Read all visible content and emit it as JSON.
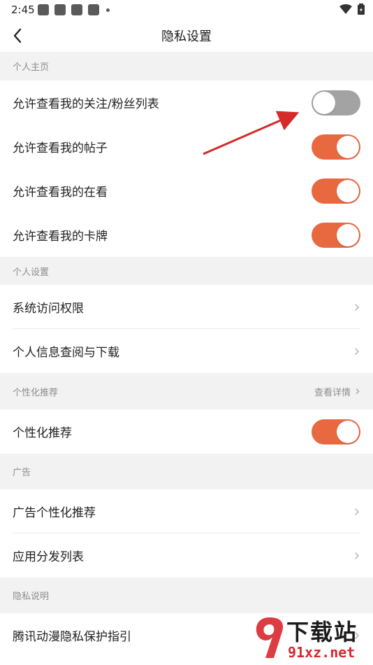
{
  "status_bar": {
    "time": "2:45"
  },
  "header": {
    "title": "隐私设置"
  },
  "sections": {
    "personal_home": {
      "label": "个人主页",
      "items": [
        {
          "label": "允许查看我的关注/粉丝列表",
          "toggle": "off"
        },
        {
          "label": "允许查看我的帖子",
          "toggle": "on"
        },
        {
          "label": "允许查看我的在看",
          "toggle": "on"
        },
        {
          "label": "允许查看我的卡牌",
          "toggle": "on"
        }
      ]
    },
    "personal_settings": {
      "label": "个人设置",
      "items": [
        {
          "label": "系统访问权限"
        },
        {
          "label": "个人信息查阅与下载"
        }
      ]
    },
    "personalized": {
      "label": "个性化推荐",
      "more_label": "查看详情",
      "items": [
        {
          "label": "个性化推荐",
          "toggle": "on"
        }
      ]
    },
    "ads": {
      "label": "广告",
      "items": [
        {
          "label": "广告个性化推荐"
        },
        {
          "label": "应用分发列表"
        }
      ]
    },
    "privacy_info": {
      "label": "隐私说明",
      "items": [
        {
          "label": "腾讯动漫隐私保护指引"
        }
      ]
    }
  },
  "watermark": {
    "brand": "下载站",
    "url": "91xz.net"
  },
  "colors": {
    "toggle_on": "#e8693f",
    "toggle_off": "#a3a3a3",
    "section_bg": "#f2f2f2",
    "annotation_arrow": "#d42a2a"
  }
}
